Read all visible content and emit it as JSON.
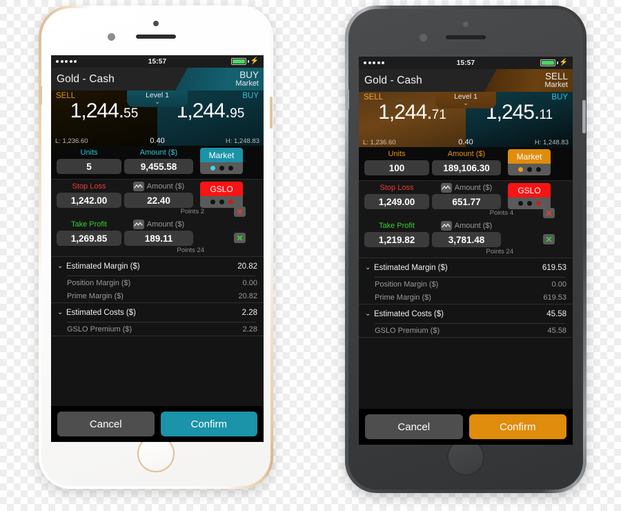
{
  "phones": [
    {
      "id": "left",
      "body": "white-gold",
      "accent": "#1b93a8",
      "accent_text": "#2ec3d8",
      "status_bar": {
        "signal_dots": 5,
        "time": "15:57",
        "battery_charging": true,
        "battery_color": "#4bd862"
      },
      "title": {
        "instrument": "Gold - Cash",
        "direction": "BUY",
        "direction_color": "#2ec3d8",
        "order_mode": "Market"
      },
      "price": {
        "sell_label": "SELL",
        "buy_label": "BUY",
        "sell_price_main": "1,244.",
        "sell_price_dec": "55",
        "buy_price_main": "1,244.",
        "buy_price_dec": "95",
        "low": "L: 1,236.60",
        "high": "H: 1,248.83",
        "spread": "0.40",
        "level_tab": "Level 1"
      },
      "units_row": {
        "units_label": "Units",
        "units_value": "5",
        "amount_label": "Amount ($)",
        "amount_value": "9,455.58",
        "mode_label": "Market",
        "mode_dots_active": 1
      },
      "stop_loss": {
        "label": "Stop Loss",
        "price_value": "1,242.00",
        "amount_label": "Amount ($)",
        "amount_value": "22.40",
        "tag_label": "GSLO",
        "dots_active": 3,
        "points": "Points 2",
        "remove_glyph": "✕"
      },
      "take_profit": {
        "label": "Take Profit",
        "price_value": "1,269.85",
        "amount_label": "Amount ($)",
        "amount_value": "189.11",
        "points": "Points 24",
        "remove_glyph": "✕"
      },
      "summary": [
        {
          "label": "Estimated Margin ($)",
          "value": "20.82",
          "rows": [
            {
              "label": "Position Margin ($)",
              "value": "0.00"
            },
            {
              "label": "Prime Margin ($)",
              "value": "20.82"
            }
          ]
        },
        {
          "label": "Estimated Costs ($)",
          "value": "2.28",
          "rows": [
            {
              "label": "GSLO Premium ($)",
              "value": "2.28"
            }
          ]
        }
      ],
      "actions": {
        "cancel": "Cancel",
        "confirm": "Confirm"
      }
    },
    {
      "id": "right",
      "body": "space-gray",
      "accent": "#e08c0c",
      "accent_text": "#e8911a",
      "status_bar": {
        "signal_dots": 5,
        "time": "15:57",
        "battery_charging": true,
        "battery_color": "#4bd862"
      },
      "title": {
        "instrument": "Gold - Cash",
        "direction": "SELL",
        "direction_color": "#f0f0f0",
        "order_mode": "Market"
      },
      "price": {
        "sell_label": "SELL",
        "buy_label": "BUY",
        "sell_price_main": "1,244.",
        "sell_price_dec": "71",
        "buy_price_main": "1,245.",
        "buy_price_dec": "11",
        "low": "L: 1,236.60",
        "high": "H: 1,248.83",
        "spread": "0.40",
        "level_tab": "Level 1"
      },
      "units_row": {
        "units_label": "Units",
        "units_value": "100",
        "amount_label": "Amount ($)",
        "amount_value": "189,106.30",
        "mode_label": "Market",
        "mode_dots_active": 1
      },
      "stop_loss": {
        "label": "Stop Loss",
        "price_value": "1,249.00",
        "amount_label": "Amount ($)",
        "amount_value": "651.77",
        "tag_label": "GSLO",
        "dots_active": 3,
        "points": "Points 4",
        "remove_glyph": "✕"
      },
      "take_profit": {
        "label": "Take Profit",
        "price_value": "1,219.82",
        "amount_label": "Amount ($)",
        "amount_value": "3,781.48",
        "points": "Points 24",
        "remove_glyph": "✕"
      },
      "summary": [
        {
          "label": "Estimated Margin ($)",
          "value": "619.53",
          "rows": [
            {
              "label": "Position Margin ($)",
              "value": "0.00"
            },
            {
              "label": "Prime Margin ($)",
              "value": "619.53"
            }
          ]
        },
        {
          "label": "Estimated Costs ($)",
          "value": "45.58",
          "rows": [
            {
              "label": "GSLO Premium ($)",
              "value": "45.58"
            }
          ]
        }
      ],
      "actions": {
        "cancel": "Cancel",
        "confirm": "Confirm"
      }
    }
  ],
  "colors": {
    "sell_label": "#e8911a",
    "buy_label": "#2ec3d8",
    "stop_loss": "#ef3b33",
    "take_profit": "#35cf2e",
    "gslo_tag": "#f71414",
    "screen_bg": "#000000"
  }
}
